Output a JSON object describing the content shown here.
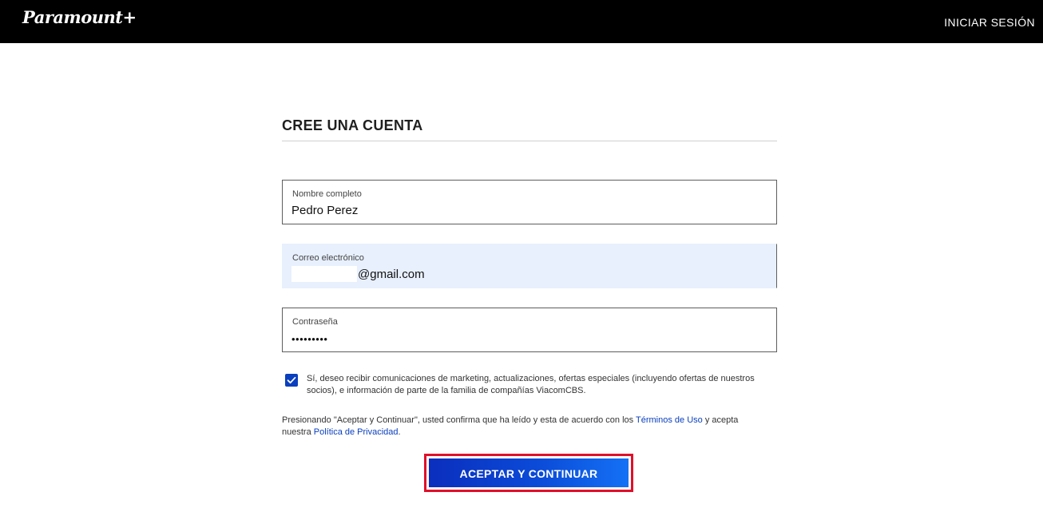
{
  "header": {
    "logo_text": "Paramount+",
    "signin_label": "INICIAR SESIÓN"
  },
  "form": {
    "title": "CREE UNA CUENTA",
    "name_field": {
      "label": "Nombre completo",
      "value": "Pedro Perez"
    },
    "email_field": {
      "label": "Correo electrónico",
      "value": "@gmail.com"
    },
    "password_field": {
      "label": "Contraseña",
      "value": "•••••••••"
    },
    "marketing_checkbox": {
      "checked": true,
      "text": "Sí, deseo recibir comunicaciones de marketing, actualizaciones, ofertas especiales (incluyendo ofertas de nuestros socios), e información de parte de la familia de compañías ViacomCBS."
    },
    "legal": {
      "prefix": "Presionando \"Aceptar y Continuar\", usted confirma que ha leído y esta de acuerdo con los ",
      "terms_link": "Términos de Uso",
      "middle": " y acepta nuestra ",
      "privacy_link": "Política de Privacidad",
      "suffix": "."
    },
    "submit_label": "ACEPTAR Y CONTINUAR"
  },
  "colors": {
    "accent": "#0a3fbe",
    "highlight": "#e0102a",
    "autofill_bg": "#e8f0fe"
  }
}
